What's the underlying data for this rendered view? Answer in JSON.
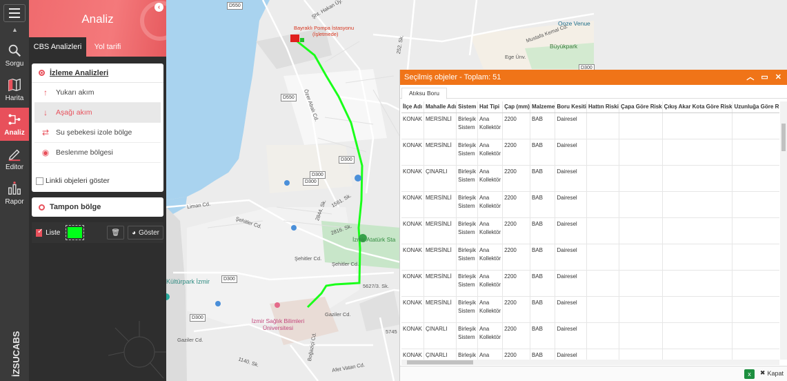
{
  "rail": {
    "items": [
      {
        "label": "Sorgu",
        "icon": "search-icon"
      },
      {
        "label": "Harita",
        "icon": "map-icon"
      },
      {
        "label": "Analiz",
        "icon": "analysis-icon"
      },
      {
        "label": "Editor",
        "icon": "pencil-icon"
      },
      {
        "label": "Rapor",
        "icon": "report-icon"
      }
    ],
    "active": "Analiz",
    "brand": "İZSUCABS"
  },
  "panel": {
    "title": "Analiz",
    "tabs": [
      "CBS Analizleri",
      "Yol tarifi"
    ],
    "monitoring": {
      "title": "İzleme Analizleri",
      "options": [
        {
          "label": "Yukarı akım",
          "icon": "arrow-up-icon"
        },
        {
          "label": "Aşağı akım",
          "icon": "arrow-down-icon"
        },
        {
          "label": "Su şebekesi izole bölge",
          "icon": "swap-icon"
        },
        {
          "label": "Beslenme bölgesi",
          "icon": "target-icon"
        }
      ],
      "selected": "Aşağı akım",
      "linked_label": "Linkli objeleri göster"
    },
    "buffer": {
      "title": "Tampon bölge"
    },
    "toolbar": {
      "list_label": "Liste",
      "show_label": "Göster",
      "color": "#00ff19"
    }
  },
  "map": {
    "labels": {
      "station": "Bayraklı Pompa İstasyonu",
      "station_sub": "(İşletmede)",
      "park": "Büyükpark",
      "ooze": "Ooze Venue",
      "hospital": "İzmir Sağlık Bilimleri Üniversitesi",
      "stadium": "İzmir Atatürk Sta",
      "kulturpark": "Kültürpark İzmir",
      "ege": "Ege Ünv.",
      "limancd": "Liman Cd.",
      "sehitler": "Şehitler Cd.",
      "sehitler2": "Şehitler Cd.",
      "gazilercd": "Gaziler Cd.",
      "gazilercd2": "Gaziler Cd.",
      "mustafakemal": "Mustafa Kemal Cd.",
      "sk1561": "1561. Sk.",
      "sk2844": "2844. Sk.",
      "sk2816": "2816. Sk.",
      "sk5627": "5627/3. Sk.",
      "sk1140": "1140. Sk.",
      "sk5745": "5745",
      "sk252": "252. Sk.",
      "hakan": "Şht. Hakan Üy.",
      "ozerabali": "Özer Abalı Cd.",
      "afevatan": "Afet Vatan Cd.",
      "bogazici": "Boğaziçi Cd."
    },
    "roads": [
      "D550",
      "D550",
      "D300",
      "D300",
      "D300",
      "D300",
      "D300",
      "D300"
    ]
  },
  "objects": {
    "title": "Seçilmiş objeler - Toplam: 51",
    "tab": "Atıksu Boru",
    "columns": [
      "İlçe Adı",
      "Mahalle Adı",
      "Sistem",
      "Hat Tipi",
      "Çap (mm)",
      "Malzeme",
      "Boru Kesiti",
      "Hattın Riski",
      "Çapa Göre Risk",
      "Çıkış Akar Kota Göre Risk",
      "Uzunluğa Göre Ri"
    ],
    "rows": [
      [
        "KONAK",
        "MERSİNLİ",
        "Birleşik Sistem",
        "Ana Kollektör",
        "2200",
        "BAB",
        "Dairesel",
        "",
        "",
        "",
        ""
      ],
      [
        "KONAK",
        "MERSİNLİ",
        "Birleşik Sistem",
        "Ana Kollektör",
        "2200",
        "BAB",
        "Dairesel",
        "",
        "",
        "",
        ""
      ],
      [
        "KONAK",
        "ÇINARLI",
        "Birleşik Sistem",
        "Ana Kollektör",
        "2200",
        "BAB",
        "Dairesel",
        "",
        "",
        "",
        ""
      ],
      [
        "KONAK",
        "MERSİNLİ",
        "Birleşik Sistem",
        "Ana Kollektör",
        "2200",
        "BAB",
        "Dairesel",
        "",
        "",
        "",
        ""
      ],
      [
        "KONAK",
        "MERSİNLİ",
        "Birleşik Sistem",
        "Ana Kollektör",
        "2200",
        "BAB",
        "Dairesel",
        "",
        "",
        "",
        ""
      ],
      [
        "KONAK",
        "MERSİNLİ",
        "Birleşik Sistem",
        "Ana Kollektör",
        "2200",
        "BAB",
        "Dairesel",
        "",
        "",
        "",
        ""
      ],
      [
        "KONAK",
        "MERSİNLİ",
        "Birleşik Sistem",
        "Ana Kollektör",
        "2200",
        "BAB",
        "Dairesel",
        "",
        "",
        "",
        ""
      ],
      [
        "KONAK",
        "MERSİNLİ",
        "Birleşik Sistem",
        "Ana Kollektör",
        "2200",
        "BAB",
        "Dairesel",
        "",
        "",
        "",
        ""
      ],
      [
        "KONAK",
        "ÇINARLI",
        "Birleşik Sistem",
        "Ana Kollektör",
        "2200",
        "BAB",
        "Dairesel",
        "",
        "",
        "",
        ""
      ],
      [
        "KONAK",
        "ÇINARLI",
        "Birleşik Sistem",
        "Ana Kollektör",
        "2200",
        "BAB",
        "Dairesel",
        "",
        "",
        "",
        ""
      ]
    ],
    "close_label": "Kapat"
  }
}
